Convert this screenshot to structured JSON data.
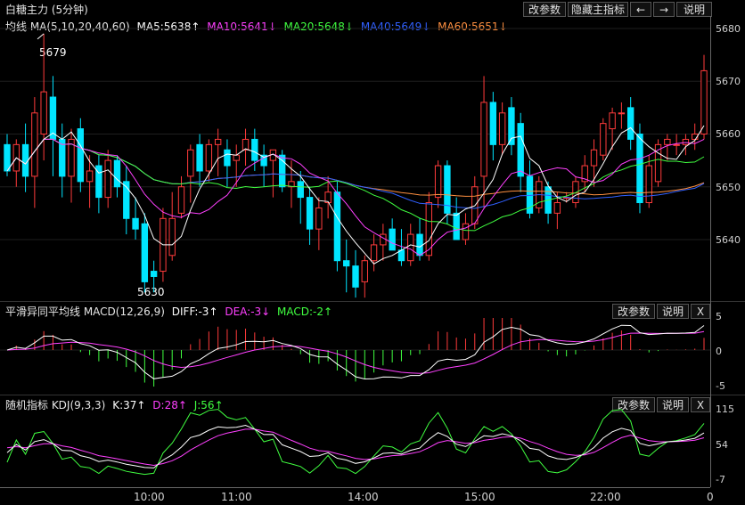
{
  "window": {
    "title": "白糖主力 (5分钟)"
  },
  "toolbar": {
    "params_label": "改参数",
    "hide_label": "隐藏主指标",
    "left_arrow": "🡐",
    "right_arrow": "🡒",
    "help_label": "说明"
  },
  "main_panel": {
    "indicator": "均线 MA(5,10,20,40,60)",
    "ma5": "MA5:5638↑",
    "ma10": "MA10:5641↓",
    "ma20": "MA20:5648↓",
    "ma40": "MA40:5649↓",
    "ma60": "MA60:5651↓",
    "high_label": "5679",
    "low_label": "5630",
    "y_ticks": [
      "5680",
      "5670",
      "5660",
      "5650",
      "5640"
    ]
  },
  "macd_panel": {
    "indicator": "平滑异同平均线 MACD(12,26,9)",
    "diff": "DIFF:-3↑",
    "dea": "DEA:-3↓",
    "macd": "MACD:-2↑",
    "params_label": "改参数",
    "help_label": "说明",
    "close_label": "X",
    "y_ticks": [
      "5",
      "0",
      "-5"
    ]
  },
  "kdj_panel": {
    "indicator": "随机指标 KDJ(9,3,3)",
    "k": "K:37↑",
    "d": "D:28↑",
    "j": "J:56↑",
    "params_label": "改参数",
    "help_label": "说明",
    "close_label": "X",
    "y_ticks": [
      "115",
      "54",
      "-7"
    ]
  },
  "x_axis": {
    "ticks": [
      "10:00",
      "11:00",
      "14:00",
      "15:00",
      "22:00",
      "0"
    ]
  },
  "colors": {
    "up": "#ff3b3b",
    "down": "#00e5ff",
    "ma5": "#ffffff",
    "ma10": "#ff40ff",
    "ma20": "#40ff40",
    "ma40": "#3060ff",
    "ma60": "#ff9040"
  },
  "chart_data": {
    "type": "candlestick",
    "candles": [
      {
        "o": 5658,
        "h": 5660,
        "l": 5652,
        "c": 5653
      },
      {
        "o": 5653,
        "h": 5659,
        "l": 5650,
        "c": 5658
      },
      {
        "o": 5658,
        "h": 5662,
        "l": 5649,
        "c": 5652
      },
      {
        "o": 5652,
        "h": 5667,
        "l": 5646,
        "c": 5664
      },
      {
        "o": 5660,
        "h": 5679,
        "l": 5655,
        "c": 5668
      },
      {
        "o": 5667,
        "h": 5671,
        "l": 5652,
        "c": 5659
      },
      {
        "o": 5659,
        "h": 5662,
        "l": 5648,
        "c": 5652
      },
      {
        "o": 5652,
        "h": 5661,
        "l": 5647,
        "c": 5659
      },
      {
        "o": 5661,
        "h": 5663,
        "l": 5649,
        "c": 5651
      },
      {
        "o": 5651,
        "h": 5656,
        "l": 5646,
        "c": 5653
      },
      {
        "o": 5654,
        "h": 5656,
        "l": 5645,
        "c": 5648
      },
      {
        "o": 5648,
        "h": 5657,
        "l": 5646,
        "c": 5655
      },
      {
        "o": 5655,
        "h": 5656,
        "l": 5648,
        "c": 5650
      },
      {
        "o": 5651,
        "h": 5654,
        "l": 5641,
        "c": 5644
      },
      {
        "o": 5644,
        "h": 5648,
        "l": 5640,
        "c": 5642
      },
      {
        "o": 5643,
        "h": 5645,
        "l": 5630,
        "c": 5632
      },
      {
        "o": 5634,
        "h": 5636,
        "l": 5630,
        "c": 5633
      },
      {
        "o": 5634,
        "h": 5646,
        "l": 5632,
        "c": 5644
      },
      {
        "o": 5637,
        "h": 5649,
        "l": 5636,
        "c": 5644
      },
      {
        "o": 5645,
        "h": 5652,
        "l": 5644,
        "c": 5650
      },
      {
        "o": 5652,
        "h": 5658,
        "l": 5647,
        "c": 5657
      },
      {
        "o": 5658,
        "h": 5660,
        "l": 5650,
        "c": 5653
      },
      {
        "o": 5653,
        "h": 5659,
        "l": 5651,
        "c": 5658
      },
      {
        "o": 5658,
        "h": 5661,
        "l": 5652,
        "c": 5659
      },
      {
        "o": 5657,
        "h": 5659,
        "l": 5650,
        "c": 5654
      },
      {
        "o": 5655,
        "h": 5658,
        "l": 5650,
        "c": 5656
      },
      {
        "o": 5657,
        "h": 5661,
        "l": 5654,
        "c": 5659
      },
      {
        "o": 5659,
        "h": 5661,
        "l": 5653,
        "c": 5655
      },
      {
        "o": 5656,
        "h": 5658,
        "l": 5650,
        "c": 5654
      },
      {
        "o": 5655,
        "h": 5657,
        "l": 5648,
        "c": 5657
      },
      {
        "o": 5656,
        "h": 5657,
        "l": 5649,
        "c": 5650
      },
      {
        "o": 5650,
        "h": 5655,
        "l": 5646,
        "c": 5651
      },
      {
        "o": 5651,
        "h": 5653,
        "l": 5643,
        "c": 5648
      },
      {
        "o": 5648,
        "h": 5650,
        "l": 5639,
        "c": 5642
      },
      {
        "o": 5642,
        "h": 5648,
        "l": 5638,
        "c": 5646
      },
      {
        "o": 5647,
        "h": 5652,
        "l": 5644,
        "c": 5649
      },
      {
        "o": 5649,
        "h": 5651,
        "l": 5634,
        "c": 5636
      },
      {
        "o": 5636,
        "h": 5640,
        "l": 5630,
        "c": 5635
      },
      {
        "o": 5635,
        "h": 5638,
        "l": 5629,
        "c": 5631
      },
      {
        "o": 5632,
        "h": 5637,
        "l": 5629,
        "c": 5636
      },
      {
        "o": 5636,
        "h": 5641,
        "l": 5634,
        "c": 5639
      },
      {
        "o": 5639,
        "h": 5643,
        "l": 5636,
        "c": 5641
      },
      {
        "o": 5642,
        "h": 5644,
        "l": 5638,
        "c": 5638
      },
      {
        "o": 5638,
        "h": 5642,
        "l": 5635,
        "c": 5636
      },
      {
        "o": 5636,
        "h": 5643,
        "l": 5635,
        "c": 5641
      },
      {
        "o": 5641,
        "h": 5644,
        "l": 5636,
        "c": 5637
      },
      {
        "o": 5637,
        "h": 5649,
        "l": 5636,
        "c": 5647
      },
      {
        "o": 5648,
        "h": 5655,
        "l": 5646,
        "c": 5654
      },
      {
        "o": 5654,
        "h": 5655,
        "l": 5643,
        "c": 5645
      },
      {
        "o": 5645,
        "h": 5648,
        "l": 5640,
        "c": 5640
      },
      {
        "o": 5640,
        "h": 5645,
        "l": 5639,
        "c": 5643
      },
      {
        "o": 5643,
        "h": 5652,
        "l": 5642,
        "c": 5650
      },
      {
        "o": 5652,
        "h": 5671,
        "l": 5646,
        "c": 5666
      },
      {
        "o": 5666,
        "h": 5668,
        "l": 5655,
        "c": 5658
      },
      {
        "o": 5658,
        "h": 5666,
        "l": 5656,
        "c": 5664
      },
      {
        "o": 5665,
        "h": 5667,
        "l": 5656,
        "c": 5658
      },
      {
        "o": 5662,
        "h": 5664,
        "l": 5649,
        "c": 5652
      },
      {
        "o": 5652,
        "h": 5655,
        "l": 5644,
        "c": 5645
      },
      {
        "o": 5646,
        "h": 5652,
        "l": 5645,
        "c": 5651
      },
      {
        "o": 5650,
        "h": 5651,
        "l": 5643,
        "c": 5645
      },
      {
        "o": 5645,
        "h": 5649,
        "l": 5642,
        "c": 5647
      },
      {
        "o": 5648,
        "h": 5649,
        "l": 5647,
        "c": 5648
      },
      {
        "o": 5647,
        "h": 5652,
        "l": 5646,
        "c": 5651
      },
      {
        "o": 5651,
        "h": 5656,
        "l": 5649,
        "c": 5654
      },
      {
        "o": 5654,
        "h": 5659,
        "l": 5650,
        "c": 5657
      },
      {
        "o": 5656,
        "h": 5663,
        "l": 5655,
        "c": 5662
      },
      {
        "o": 5661,
        "h": 5665,
        "l": 5657,
        "c": 5664
      },
      {
        "o": 5664,
        "h": 5666,
        "l": 5661,
        "c": 5664
      },
      {
        "o": 5665,
        "h": 5667,
        "l": 5657,
        "c": 5659
      },
      {
        "o": 5660,
        "h": 5662,
        "l": 5645,
        "c": 5647
      },
      {
        "o": 5647,
        "h": 5656,
        "l": 5646,
        "c": 5654
      },
      {
        "o": 5651,
        "h": 5659,
        "l": 5650,
        "c": 5658
      },
      {
        "o": 5658,
        "h": 5660,
        "l": 5655,
        "c": 5659
      },
      {
        "o": 5658,
        "h": 5660,
        "l": 5656,
        "c": 5658
      },
      {
        "o": 5658,
        "h": 5660,
        "l": 5656,
        "c": 5659
      },
      {
        "o": 5659,
        "h": 5662,
        "l": 5657,
        "c": 5660
      },
      {
        "o": 5660,
        "h": 5675,
        "l": 5659,
        "c": 5672
      }
    ]
  }
}
